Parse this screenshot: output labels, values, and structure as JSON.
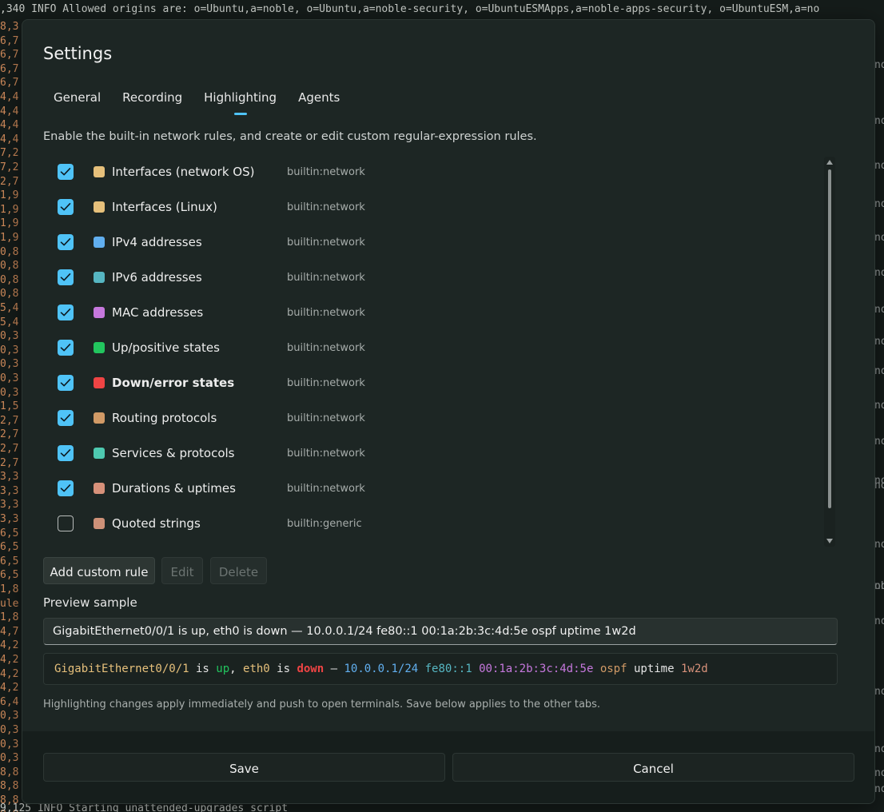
{
  "terminal": {
    "line_top": ",340 INFO Allowed origins are: o=Ubuntu,a=noble, o=Ubuntu,a=noble-security, o=UbuntuESMApps,a=noble-apps-security, o=UbuntuESM,a=no",
    "line_bottom": "9,125 INFO Starting unattended-upgrades script",
    "gutter": [
      "8,3",
      "6,7",
      "6,7",
      "6,7",
      "6,7",
      "4,4",
      "4,4",
      "4,4",
      "4,4",
      "7,2",
      "7,2",
      "2,7",
      "1,9",
      "1,9",
      "1,9",
      "1,9",
      "0,8",
      "0,8",
      "0,8",
      "0,8",
      "5,4",
      "5,4",
      "0,3",
      "0,3",
      "0,3",
      "0,3",
      "0,3",
      "1,5",
      "2,7",
      "2,7",
      "2,7",
      "2,7",
      "3,3",
      "3,3",
      "3,3",
      "3,3",
      "6,5",
      "6,5",
      "6,5",
      "6,5",
      "1,8",
      "ule",
      "1,8",
      "4,7",
      "4,2",
      "4,2",
      "4,2",
      "4,2",
      "6,4",
      "0,3",
      "0,3",
      "0,3",
      "0,3",
      "8,8",
      "8,8",
      "8,8",
      "8,8"
    ],
    "right_fragments": [
      "no",
      "no",
      "no",
      "no",
      "no",
      "no",
      "no",
      "no",
      "no",
      "no",
      "no",
      "no",
      "no",
      "no",
      "no",
      "ohe",
      "no",
      "no",
      "no",
      "no",
      "no"
    ]
  },
  "dialog": {
    "title": "Settings",
    "tabs": [
      {
        "label": "General",
        "active": false
      },
      {
        "label": "Recording",
        "active": false
      },
      {
        "label": "Highlighting",
        "active": true
      },
      {
        "label": "Agents",
        "active": false
      }
    ],
    "description": "Enable the built-in network rules, and create or edit custom regular-expression rules.",
    "rules": [
      {
        "name": "Interfaces (network OS)",
        "source": "builtin:network",
        "enabled": true,
        "color": "#e6c07b",
        "bold": false
      },
      {
        "name": "Interfaces (Linux)",
        "source": "builtin:network",
        "enabled": true,
        "color": "#e6c07b",
        "bold": false
      },
      {
        "name": "IPv4 addresses",
        "source": "builtin:network",
        "enabled": true,
        "color": "#61afef",
        "bold": false
      },
      {
        "name": "IPv6 addresses",
        "source": "builtin:network",
        "enabled": true,
        "color": "#56b6c2",
        "bold": false
      },
      {
        "name": "MAC addresses",
        "source": "builtin:network",
        "enabled": true,
        "color": "#c678dd",
        "bold": false
      },
      {
        "name": "Up/positive states",
        "source": "builtin:network",
        "enabled": true,
        "color": "#22c55e",
        "bold": false
      },
      {
        "name": "Down/error states",
        "source": "builtin:network",
        "enabled": true,
        "color": "#ef4444",
        "bold": true
      },
      {
        "name": "Routing protocols",
        "source": "builtin:network",
        "enabled": true,
        "color": "#d19a66",
        "bold": false
      },
      {
        "name": "Services & protocols",
        "source": "builtin:network",
        "enabled": true,
        "color": "#4ec9b0",
        "bold": false
      },
      {
        "name": "Durations & uptimes",
        "source": "builtin:network",
        "enabled": true,
        "color": "#d7917a",
        "bold": false
      },
      {
        "name": "Quoted strings",
        "source": "builtin:generic",
        "enabled": false,
        "color": "#ce9178",
        "bold": false
      }
    ],
    "buttons": {
      "add": "Add custom rule",
      "edit": "Edit",
      "delete": "Delete"
    },
    "preview": {
      "label": "Preview sample",
      "input_value": "GigabitEthernet0/0/1 is up, eth0 is down — 10.0.0.1/24 fe80::1 00:1a:2b:3c:4d:5e ospf uptime 1w2d",
      "tokens": [
        {
          "text": "GigabitEthernet0/0/1",
          "color": "#e6c07b",
          "bold": false
        },
        {
          "text": " is ",
          "color": "",
          "bold": false
        },
        {
          "text": "up",
          "color": "#22c55e",
          "bold": false
        },
        {
          "text": ", ",
          "color": "",
          "bold": false
        },
        {
          "text": "eth0",
          "color": "#e6c07b",
          "bold": false
        },
        {
          "text": " is ",
          "color": "",
          "bold": false
        },
        {
          "text": "down",
          "color": "#ef4444",
          "bold": true
        },
        {
          "text": " — ",
          "color": "",
          "bold": false
        },
        {
          "text": "10.0.0.1/24",
          "color": "#61afef",
          "bold": false
        },
        {
          "text": " ",
          "color": "",
          "bold": false
        },
        {
          "text": "fe80::1",
          "color": "#56b6c2",
          "bold": false
        },
        {
          "text": " ",
          "color": "",
          "bold": false
        },
        {
          "text": "00:1a:2b:3c:4d:5e",
          "color": "#c678dd",
          "bold": false
        },
        {
          "text": " ",
          "color": "",
          "bold": false
        },
        {
          "text": "ospf",
          "color": "#d19a66",
          "bold": false
        },
        {
          "text": " uptime ",
          "color": "",
          "bold": false
        },
        {
          "text": "1w2d",
          "color": "#d7917a",
          "bold": false
        }
      ]
    },
    "note": "Highlighting changes apply immediately and push to open terminals. Save below applies to the other tabs.",
    "footer": {
      "save": "Save",
      "cancel": "Cancel"
    },
    "accent": "#4fc3f7"
  }
}
